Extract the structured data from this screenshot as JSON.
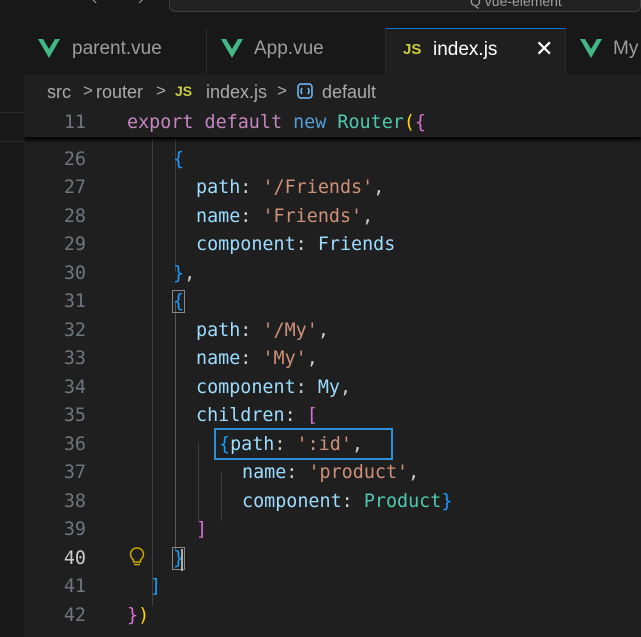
{
  "titlebar": {
    "back_arrow": "‹",
    "forward_arrow": "›",
    "search_text": "Q vue-element"
  },
  "tabs": [
    {
      "label": "parent.vue",
      "icon": "vue-icon"
    },
    {
      "label": "App.vue",
      "icon": "vue-icon"
    },
    {
      "label": "index.js",
      "icon": "js-icon",
      "icon_text": "JS",
      "active": true,
      "close": "✕"
    },
    {
      "label": "My",
      "icon": "vue-icon"
    }
  ],
  "breadcrumb": {
    "items": [
      "src",
      "router",
      "index.js",
      "default"
    ],
    "separator": ">",
    "js_badge": "JS"
  },
  "editor": {
    "sticky_line": {
      "number": "11",
      "text": "export default new Router({"
    },
    "current_line": "40",
    "lines": [
      {
        "number": "26",
        "text": "{"
      },
      {
        "number": "27",
        "text": "path: '/Friends',"
      },
      {
        "number": "28",
        "text": "name: 'Friends',"
      },
      {
        "number": "29",
        "text": "component: Friends"
      },
      {
        "number": "30",
        "text": "},"
      },
      {
        "number": "31",
        "text": "{"
      },
      {
        "number": "32",
        "text": "path: '/My',"
      },
      {
        "number": "33",
        "text": "name: 'My',"
      },
      {
        "number": "34",
        "text": "component: My,"
      },
      {
        "number": "35",
        "text": "children: ["
      },
      {
        "number": "36",
        "text": "{path: ':id',"
      },
      {
        "number": "37",
        "text": "name: 'product',"
      },
      {
        "number": "38",
        "text": "component: Product}"
      },
      {
        "number": "39",
        "text": "]"
      },
      {
        "number": "40",
        "text": "}"
      },
      {
        "number": "41",
        "text": "]"
      },
      {
        "number": "42",
        "text": "})"
      }
    ]
  },
  "colors": {
    "background": "#1f1f1f",
    "keyword": "#569cd6",
    "control_keyword": "#c586c0",
    "class_name": "#4ec9b0",
    "property": "#9cdcfe",
    "string": "#ce9178",
    "bracket_level1": "#ffd700",
    "bracket_level2": "#da70d6",
    "bracket_level3": "#179fff",
    "selection_box": "#2f8fd8"
  }
}
